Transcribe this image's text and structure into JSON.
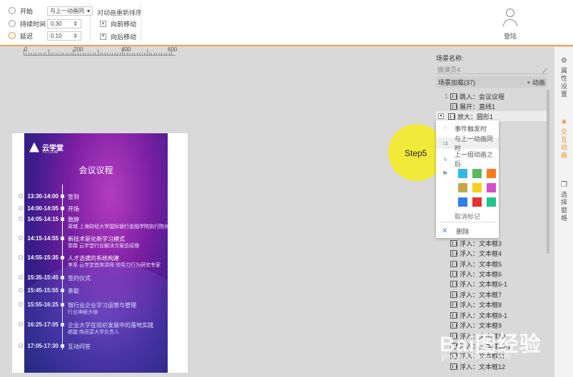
{
  "toolbar": {
    "start_label": "开始",
    "start_value": "与上一动画同",
    "duration_label": "持续时间",
    "duration_value": "0.30",
    "delay_label": "延迟",
    "delay_value": "0.10",
    "reorder_title": "对动画重新排序",
    "move_forward": "向前移动",
    "move_backward": "向后移动",
    "login": "登陆"
  },
  "ruler": {
    "labels": [
      "0",
      "200",
      "400",
      "600"
    ]
  },
  "slide": {
    "logo_text": "云学堂",
    "logo_sub": "YXT.COM",
    "title": "会议议程",
    "agenda": [
      {
        "time": "13:30-14:00",
        "title": "签到",
        "sub": ""
      },
      {
        "time": "14:00-14:05",
        "title": "开场",
        "sub": ""
      },
      {
        "time": "14:05-14:15",
        "title": "致辞",
        "sub": "周城 上海财经大学国际银行金融学院执行院长"
      },
      {
        "time": "14:15-14:55",
        "title": "新技术驱化新学习模式",
        "sub": "郭霖 云学堂行业解决方案总经理"
      },
      {
        "time": "14:55-15:35",
        "title": "人才选拔的系统构建",
        "sub": "李萃 云学堂首席讲师 领导力行为研究专家"
      },
      {
        "time": "15:35-15:45",
        "title": "签约仪式",
        "sub": ""
      },
      {
        "time": "15:45-15:55",
        "title": "茶歇",
        "sub": ""
      },
      {
        "time": "15:55-16:25",
        "title": "银行业企业学习运营与管理",
        "sub": "行业神秘大咖"
      },
      {
        "time": "16:25-17:05",
        "title": "企业大学在组织发展中的落地实践",
        "sub": "郝震 皓而富大学负责人"
      },
      {
        "time": "17:05-17:30",
        "title": "互动问答",
        "sub": ""
      }
    ]
  },
  "step_label": "Step5",
  "panel": {
    "scene_name_label": "场景名称:",
    "scene_name_value": "微课页4",
    "load_label": "场景加载(37)",
    "add_anim": "+ 动画",
    "items": [
      {
        "num": "1",
        "text": "跳入：会议议程"
      },
      {
        "num": "",
        "text": "展开：直线1"
      },
      {
        "num": "",
        "text": "放大：圆形1"
      },
      {
        "num": "",
        "text": "浮入：文本框3"
      },
      {
        "num": "",
        "text": "浮入：文本框4"
      },
      {
        "num": "",
        "text": "浮入：文本框5"
      },
      {
        "num": "",
        "text": "浮入：文本框6"
      },
      {
        "num": "",
        "text": "浮入：文本框6-1"
      },
      {
        "num": "",
        "text": "浮入：文本框7"
      },
      {
        "num": "",
        "text": "浮入：文本框8"
      },
      {
        "num": "",
        "text": "浮入：文本框8-1"
      },
      {
        "num": "",
        "text": "浮入：文本框9"
      },
      {
        "num": "",
        "text": "浮入：文本框10"
      },
      {
        "num": "",
        "text": "浮入：文本框10-1"
      },
      {
        "num": "",
        "text": "浮入：文本框11"
      },
      {
        "num": "",
        "text": "浮入：文本框12"
      }
    ]
  },
  "context_menu": {
    "event_trigger": "事件触发时",
    "with_previous": "与上一动画同时",
    "after_previous": "上一组动画之后",
    "swatches": [
      "#2fb8e8",
      "#5cb85c",
      "#ff7a1a",
      "#c8a44a",
      "#f5d21a",
      "#d64fc8",
      "#2f7fe8",
      "#e8302f",
      "#1fc48c"
    ],
    "cancel_mark": "取消标记",
    "delete": "删除"
  },
  "rail": {
    "properties": "属性设置",
    "interaction": "交互动画",
    "selection": "选择窗格"
  },
  "watermark": {
    "main": "Bai图经验",
    "sub": "jingyan.baidu.com"
  }
}
